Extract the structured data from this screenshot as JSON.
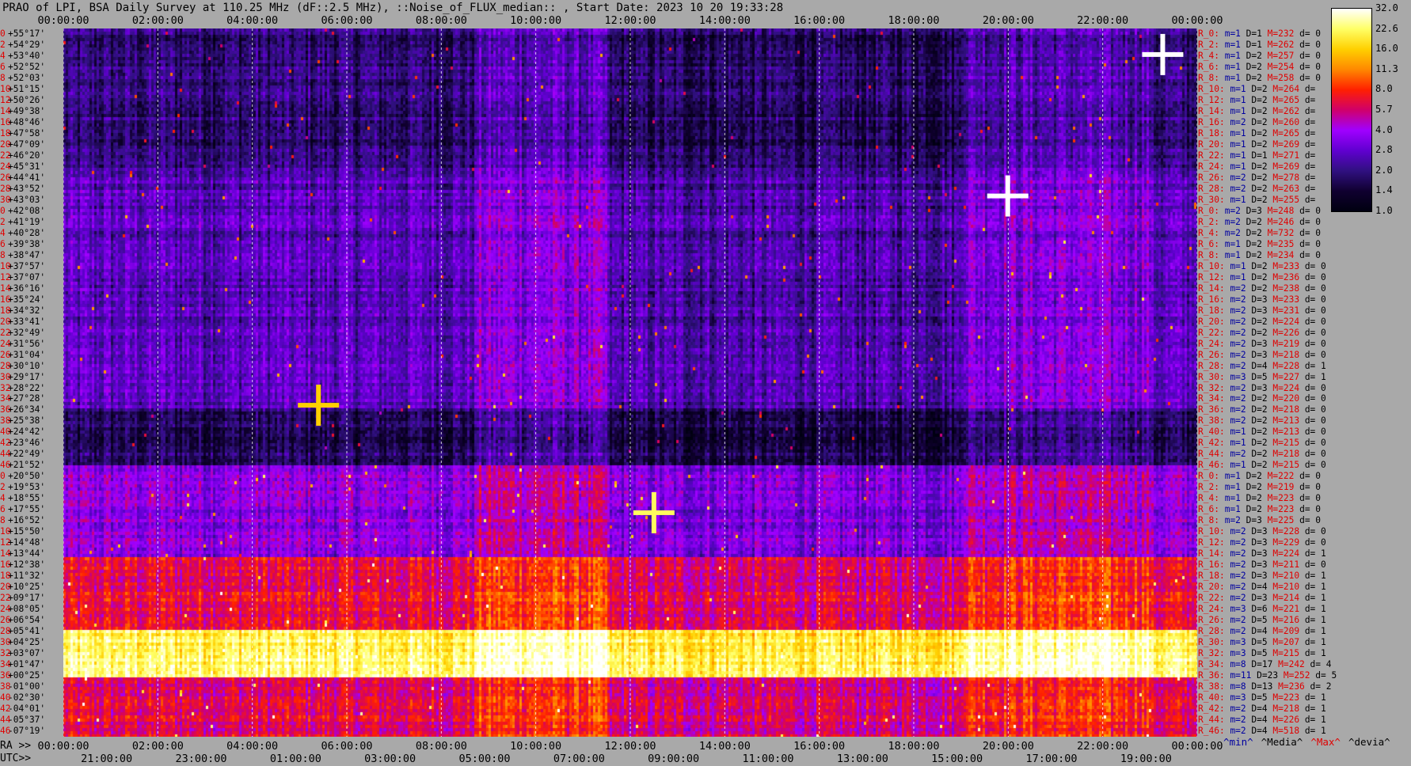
{
  "title": "PRAO of LPI, BSA Daily Survey at 110.25 MHz (dF::2.5 MHz), ::Noise_of_FLUX_median:: , Start Date: 2023 10 20 19:33:28",
  "top_ticks": [
    "00:00:00",
    "02:00:00",
    "04:00:00",
    "06:00:00",
    "08:00:00",
    "10:00:00",
    "12:00:00",
    "14:00:00",
    "16:00:00",
    "18:00:00",
    "20:00:00",
    "22:00:00",
    "00:00:00"
  ],
  "bottom_ra_label": "RA >>",
  "bottom_ra_ticks": [
    "00:00:00",
    "02:00:00",
    "04:00:00",
    "06:00:00",
    "08:00:00",
    "10:00:00",
    "12:00:00",
    "14:00:00",
    "16:00:00",
    "18:00:00",
    "20:00:00",
    "22:00:00",
    "00:00:00"
  ],
  "bottom_utc_label": "UTC>>",
  "bottom_utc_ticks": [
    "21:00:00",
    "23:00:00",
    "01:00:00",
    "03:00:00",
    "05:00:00",
    "07:00:00",
    "09:00:00",
    "11:00:00",
    "13:00:00",
    "15:00:00",
    "17:00:00",
    "19:00:00"
  ],
  "legend_keys": [
    {
      "text": "^min^",
      "color": "#0000a0"
    },
    {
      "text": "^Media^",
      "color": "#000000"
    },
    {
      "text": "^Max^",
      "color": "#e00000"
    },
    {
      "text": "^devia^",
      "color": "#000000"
    }
  ],
  "colorbar": {
    "ticks": [
      "32.0",
      "22.6",
      "16.0",
      "11.3",
      "8.0",
      "5.7",
      "4.0",
      "2.8",
      "2.0",
      "1.4",
      "1.0"
    ],
    "colors": [
      "#ffffff",
      "#ffff66",
      "#ffd000",
      "#ff8800",
      "#ff2000",
      "#d0006a",
      "#a000ff",
      "#6000d0",
      "#301080",
      "#100030",
      "#000010"
    ]
  },
  "rows": [
    {
      "i": "0",
      "dec": "+55°17'",
      "r": "R_0:",
      "m": "m=1",
      "D": "D=1",
      "M": "M=232",
      "d": "d= 0"
    },
    {
      "i": "2",
      "dec": "+54°29'",
      "r": "R_2:",
      "m": "m=1",
      "D": "D=1",
      "M": "M=262",
      "d": "d= 0"
    },
    {
      "i": "4",
      "dec": "+53°40'",
      "r": "R_4:",
      "m": "m=1",
      "D": "D=2",
      "M": "M=257",
      "d": "d= 0"
    },
    {
      "i": "6",
      "dec": "+52°52'",
      "r": "R_6:",
      "m": "m=1",
      "D": "D=2",
      "M": "M=254",
      "d": "d= 0"
    },
    {
      "i": "8",
      "dec": "+52°03'",
      "r": "R_8:",
      "m": "m=1",
      "D": "D=2",
      "M": "M=258",
      "d": "d= 0"
    },
    {
      "i": "10",
      "dec": "+51°15'",
      "r": "R_10:",
      "m": "m=1",
      "D": "D=2",
      "M": "M=264",
      "d": "d="
    },
    {
      "i": "12",
      "dec": "+50°26'",
      "r": "R_12:",
      "m": "m=1",
      "D": "D=2",
      "M": "M=265",
      "d": "d="
    },
    {
      "i": "14",
      "dec": "+49°38'",
      "r": "R_14:",
      "m": "m=1",
      "D": "D=2",
      "M": "M=262",
      "d": "d="
    },
    {
      "i": "16",
      "dec": "+48°46'",
      "r": "R_16:",
      "m": "m=2",
      "D": "D=2",
      "M": "M=260",
      "d": "d="
    },
    {
      "i": "18",
      "dec": "+47°58'",
      "r": "R_18:",
      "m": "m=1",
      "D": "D=2",
      "M": "M=265",
      "d": "d="
    },
    {
      "i": "20",
      "dec": "+47°09'",
      "r": "R_20:",
      "m": "m=1",
      "D": "D=2",
      "M": "M=269",
      "d": "d="
    },
    {
      "i": "22",
      "dec": "+46°20'",
      "r": "R_22:",
      "m": "m=1",
      "D": "D=1",
      "M": "M=271",
      "d": "d="
    },
    {
      "i": "24",
      "dec": "+45°31'",
      "r": "R_24:",
      "m": "m=1",
      "D": "D=2",
      "M": "M=269",
      "d": "d="
    },
    {
      "i": "26",
      "dec": "+44°41'",
      "r": "R_26:",
      "m": "m=2",
      "D": "D=2",
      "M": "M=278",
      "d": "d="
    },
    {
      "i": "28",
      "dec": "+43°52'",
      "r": "R_28:",
      "m": "m=2",
      "D": "D=2",
      "M": "M=263",
      "d": "d="
    },
    {
      "i": "30",
      "dec": "+43°03'",
      "r": "R_30:",
      "m": "m=1",
      "D": "D=2",
      "M": "M=255",
      "d": "d="
    },
    {
      "i": "0",
      "dec": "+42°08'",
      "r": "R_0:",
      "m": "m=2",
      "D": "D=3",
      "M": "M=248",
      "d": "d= 0"
    },
    {
      "i": "2",
      "dec": "+41°19'",
      "r": "R_2:",
      "m": "m=2",
      "D": "D=2",
      "M": "M=246",
      "d": "d= 0"
    },
    {
      "i": "4",
      "dec": "+40°28'",
      "r": "R_4:",
      "m": "m=2",
      "D": "D=2",
      "M": "M=732",
      "d": "d= 0"
    },
    {
      "i": "6",
      "dec": "+39°38'",
      "r": "R_6:",
      "m": "m=1",
      "D": "D=2",
      "M": "M=235",
      "d": "d= 0"
    },
    {
      "i": "8",
      "dec": "+38°47'",
      "r": "R_8:",
      "m": "m=1",
      "D": "D=2",
      "M": "M=234",
      "d": "d= 0"
    },
    {
      "i": "10",
      "dec": "+37°57'",
      "r": "R_10:",
      "m": "m=1",
      "D": "D=2",
      "M": "M=233",
      "d": "d= 0"
    },
    {
      "i": "12",
      "dec": "+37°07'",
      "r": "R_12:",
      "m": "m=1",
      "D": "D=2",
      "M": "M=236",
      "d": "d= 0"
    },
    {
      "i": "14",
      "dec": "+36°16'",
      "r": "R_14:",
      "m": "m=2",
      "D": "D=2",
      "M": "M=238",
      "d": "d= 0"
    },
    {
      "i": "16",
      "dec": "+35°24'",
      "r": "R_16:",
      "m": "m=2",
      "D": "D=3",
      "M": "M=233",
      "d": "d= 0"
    },
    {
      "i": "18",
      "dec": "+34°32'",
      "r": "R_18:",
      "m": "m=2",
      "D": "D=3",
      "M": "M=231",
      "d": "d= 0"
    },
    {
      "i": "20",
      "dec": "+33°41'",
      "r": "R_20:",
      "m": "m=2",
      "D": "D=2",
      "M": "M=224",
      "d": "d= 0"
    },
    {
      "i": "22",
      "dec": "+32°49'",
      "r": "R_22:",
      "m": "m=2",
      "D": "D=2",
      "M": "M=226",
      "d": "d= 0"
    },
    {
      "i": "24",
      "dec": "+31°56'",
      "r": "R_24:",
      "m": "m=2",
      "D": "D=3",
      "M": "M=219",
      "d": "d= 0"
    },
    {
      "i": "26",
      "dec": "+31°04'",
      "r": "R_26:",
      "m": "m=2",
      "D": "D=3",
      "M": "M=218",
      "d": "d= 0"
    },
    {
      "i": "28",
      "dec": "+30°10'",
      "r": "R_28:",
      "m": "m=2",
      "D": "D=4",
      "M": "M=228",
      "d": "d= 1"
    },
    {
      "i": "30",
      "dec": "+29°17'",
      "r": "R_30:",
      "m": "m=3",
      "D": "D=5",
      "M": "M=227",
      "d": "d= 1"
    },
    {
      "i": "32",
      "dec": "+28°22'",
      "r": "R_32:",
      "m": "m=2",
      "D": "D=3",
      "M": "M=224",
      "d": "d= 0"
    },
    {
      "i": "34",
      "dec": "+27°28'",
      "r": "R_34:",
      "m": "m=2",
      "D": "D=2",
      "M": "M=220",
      "d": "d= 0"
    },
    {
      "i": "36",
      "dec": "+26°34'",
      "r": "R_36:",
      "m": "m=2",
      "D": "D=2",
      "M": "M=218",
      "d": "d= 0"
    },
    {
      "i": "38",
      "dec": "+25°38'",
      "r": "R_38:",
      "m": "m=2",
      "D": "D=2",
      "M": "M=213",
      "d": "d= 0"
    },
    {
      "i": "40",
      "dec": "+24°42'",
      "r": "R_40:",
      "m": "m=1",
      "D": "D=2",
      "M": "M=213",
      "d": "d= 0"
    },
    {
      "i": "42",
      "dec": "+23°46'",
      "r": "R_42:",
      "m": "m=1",
      "D": "D=2",
      "M": "M=215",
      "d": "d= 0"
    },
    {
      "i": "44",
      "dec": "+22°49'",
      "r": "R_44:",
      "m": "m=2",
      "D": "D=2",
      "M": "M=218",
      "d": "d= 0"
    },
    {
      "i": "46",
      "dec": "+21°52'",
      "r": "R_46:",
      "m": "m=1",
      "D": "D=2",
      "M": "M=215",
      "d": "d= 0"
    },
    {
      "i": "0",
      "dec": "+20°50'",
      "r": "R_0:",
      "m": "m=1",
      "D": "D=2",
      "M": "M=222",
      "d": "d= 0"
    },
    {
      "i": "2",
      "dec": "+19°53'",
      "r": "R_2:",
      "m": "m=1",
      "D": "D=2",
      "M": "M=219",
      "d": "d= 0"
    },
    {
      "i": "4",
      "dec": "+18°55'",
      "r": "R_4:",
      "m": "m=1",
      "D": "D=2",
      "M": "M=223",
      "d": "d= 0"
    },
    {
      "i": "6",
      "dec": "+17°55'",
      "r": "R_6:",
      "m": "m=1",
      "D": "D=2",
      "M": "M=223",
      "d": "d= 0"
    },
    {
      "i": "8",
      "dec": "+16°52'",
      "r": "R_8:",
      "m": "m=2",
      "D": "D=3",
      "M": "M=225",
      "d": "d= 0"
    },
    {
      "i": "10",
      "dec": "+15°50'",
      "r": "R_10:",
      "m": "m=2",
      "D": "D=3",
      "M": "M=228",
      "d": "d= 0"
    },
    {
      "i": "12",
      "dec": "+14°48'",
      "r": "R_12:",
      "m": "m=2",
      "D": "D=3",
      "M": "M=229",
      "d": "d= 0"
    },
    {
      "i": "14",
      "dec": "+13°44'",
      "r": "R_14:",
      "m": "m=2",
      "D": "D=3",
      "M": "M=224",
      "d": "d= 1"
    },
    {
      "i": "16",
      "dec": "+12°38'",
      "r": "R_16:",
      "m": "m=2",
      "D": "D=3",
      "M": "M=211",
      "d": "d= 0"
    },
    {
      "i": "18",
      "dec": "+11°32'",
      "r": "R_18:",
      "m": "m=2",
      "D": "D=3",
      "M": "M=210",
      "d": "d= 1"
    },
    {
      "i": "20",
      "dec": "+10°25'",
      "r": "R_20:",
      "m": "m=2",
      "D": "D=4",
      "M": "M=210",
      "d": "d= 1"
    },
    {
      "i": "22",
      "dec": "+09°17'",
      "r": "R_22:",
      "m": "m=2",
      "D": "D=3",
      "M": "M=214",
      "d": "d= 1"
    },
    {
      "i": "24",
      "dec": "+08°05'",
      "r": "R_24:",
      "m": "m=3",
      "D": "D=6",
      "M": "M=221",
      "d": "d= 1"
    },
    {
      "i": "26",
      "dec": "+06°54'",
      "r": "R_26:",
      "m": "m=2",
      "D": "D=5",
      "M": "M=216",
      "d": "d= 1"
    },
    {
      "i": "28",
      "dec": "+05°41'",
      "r": "R_28:",
      "m": "m=2",
      "D": "D=4",
      "M": "M=209",
      "d": "d= 1"
    },
    {
      "i": "30",
      "dec": "+04°25'",
      "r": "R_30:",
      "m": "m=3",
      "D": "D=5",
      "M": "M=207",
      "d": "d= 1"
    },
    {
      "i": "32",
      "dec": "+03°07'",
      "r": "R_32:",
      "m": "m=3",
      "D": "D=5",
      "M": "M=215",
      "d": "d= 1"
    },
    {
      "i": "34",
      "dec": "+01°47'",
      "r": "R_34:",
      "m": "m=8",
      "D": "D=17",
      "M": "M=242",
      "d": "d= 4"
    },
    {
      "i": "36",
      "dec": "+00°25'",
      "r": "R_36:",
      "m": "m=11",
      "D": "D=23",
      "M": "M=252",
      "d": "d= 5"
    },
    {
      "i": "38",
      "dec": "-01°00'",
      "r": "R_38:",
      "m": "m=8",
      "D": "D=13",
      "M": "M=236",
      "d": "d= 2"
    },
    {
      "i": "40",
      "dec": "-02°30'",
      "r": "R_40:",
      "m": "m=3",
      "D": "D=5",
      "M": "M=223",
      "d": "d= 1"
    },
    {
      "i": "42",
      "dec": "-04°01'",
      "r": "R_42:",
      "m": "m=2",
      "D": "D=4",
      "M": "M=218",
      "d": "d= 1"
    },
    {
      "i": "44",
      "dec": "-05°37'",
      "r": "R_44:",
      "m": "m=2",
      "D": "D=4",
      "M": "M=226",
      "d": "d= 1"
    },
    {
      "i": "46",
      "dec": "-07°19'",
      "r": "R_46:",
      "m": "m=2",
      "D": "D=4",
      "M": "M=518",
      "d": "d= 1"
    }
  ],
  "chart_data": {
    "type": "heatmap",
    "title": "PRAO of LPI, BSA Daily Survey at 110.25 MHz (dF::2.5 MHz), ::Noise_of_FLUX_median:: , Start Date: 2023 10 20 19:33:28",
    "x_axis": {
      "label_top": "",
      "label_bottom": "RA >>",
      "range_hours": [
        0,
        24
      ],
      "tick_labels": [
        "00:00:00",
        "02:00:00",
        "04:00:00",
        "06:00:00",
        "08:00:00",
        "10:00:00",
        "12:00:00",
        "14:00:00",
        "16:00:00",
        "18:00:00",
        "20:00:00",
        "22:00:00",
        "00:00:00"
      ]
    },
    "secondary_x_axis": {
      "label": "UTC>>",
      "tick_labels": [
        "21:00:00",
        "23:00:00",
        "01:00:00",
        "03:00:00",
        "05:00:00",
        "07:00:00",
        "09:00:00",
        "11:00:00",
        "13:00:00",
        "15:00:00",
        "17:00:00",
        "19:00:00"
      ]
    },
    "y_axis": {
      "declination_range_deg": [
        -7.3,
        55.3
      ]
    },
    "colorbar_range": [
      1.0,
      32.0
    ],
    "colorbar_scale": "log",
    "row_bands": [
      {
        "dec_from": 55.3,
        "dec_to": 43.0,
        "level": 1.9
      },
      {
        "dec_from": 43.0,
        "dec_to": 21.9,
        "level": 2.6
      },
      {
        "dec_from": 21.9,
        "dec_to": 16.9,
        "level": 1.7
      },
      {
        "dec_from": 16.9,
        "dec_to": 8.6,
        "level": 3.6
      },
      {
        "dec_from": 8.6,
        "dec_to": 2.4,
        "level": 6.5
      },
      {
        "dec_from": 2.4,
        "dec_to": -1.8,
        "level": 22.0
      },
      {
        "dec_from": -1.8,
        "dec_to": -7.3,
        "level": 6.0
      }
    ],
    "bright_sources": [
      {
        "ra_h": 19.99,
        "dec": 40.5,
        "level": 32.0
      },
      {
        "ra_h": 23.27,
        "dec": 53.0,
        "level": 32.0
      },
      {
        "ra_h": 12.5,
        "dec": 12.5,
        "level": 22.0
      },
      {
        "ra_h": 5.4,
        "dec": 22.0,
        "level": 16.0
      }
    ]
  }
}
